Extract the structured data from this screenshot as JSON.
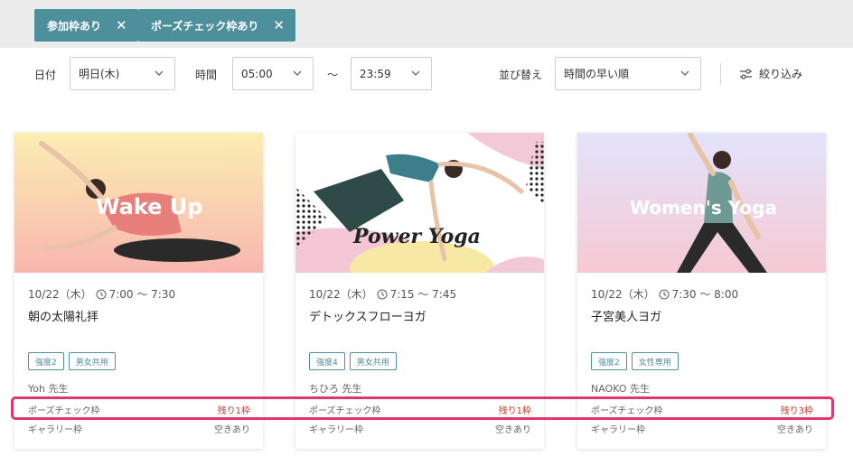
{
  "chips": [
    {
      "label": "参加枠あり",
      "close": "✕"
    },
    {
      "label": "ポーズチェック枠あり",
      "close": "✕"
    }
  ],
  "filters": {
    "date_label": "日付",
    "date_value": "明日(木)",
    "time_label": "時間",
    "time_from": "05:00",
    "tilde": "〜",
    "time_to": "23:59",
    "sort_label": "並び替え",
    "sort_value": "時間の早い順",
    "refine_label": "絞り込み"
  },
  "cards": [
    {
      "image_title": "Wake Up",
      "date": "10/22（木）",
      "time": "7:00 〜 7:30",
      "title": "朝の太陽礼拝",
      "tags": [
        "強度2",
        "男女共用"
      ],
      "teacher": "Yoh 先生",
      "pose_label": "ポーズチェック枠",
      "pose_value": "残り1枠",
      "gallery_label": "ギャラリー枠",
      "gallery_value": "空きあり"
    },
    {
      "image_title": "Power Yoga",
      "date": "10/22（木）",
      "time": "7:15 〜 7:45",
      "title": "デトックスフローヨガ",
      "tags": [
        "強度4",
        "男女共用"
      ],
      "teacher": "ちひろ 先生",
      "pose_label": "ポーズチェック枠",
      "pose_value": "残り1枠",
      "gallery_label": "ギャラリー枠",
      "gallery_value": "空きあり"
    },
    {
      "image_title": "Women's Yoga",
      "date": "10/22（木）",
      "time": "7:30 〜 8:00",
      "title": "子宮美人ヨガ",
      "tags": [
        "強度2",
        "女性専用"
      ],
      "teacher": "NAOKO 先生",
      "pose_label": "ポーズチェック枠",
      "pose_value": "残り3枠",
      "gallery_label": "ギャラリー枠",
      "gallery_value": "空きあり"
    }
  ],
  "colors": {
    "accent": "#4e8f9c",
    "remaining": "#c0392b",
    "highlight": "#e0386e"
  }
}
